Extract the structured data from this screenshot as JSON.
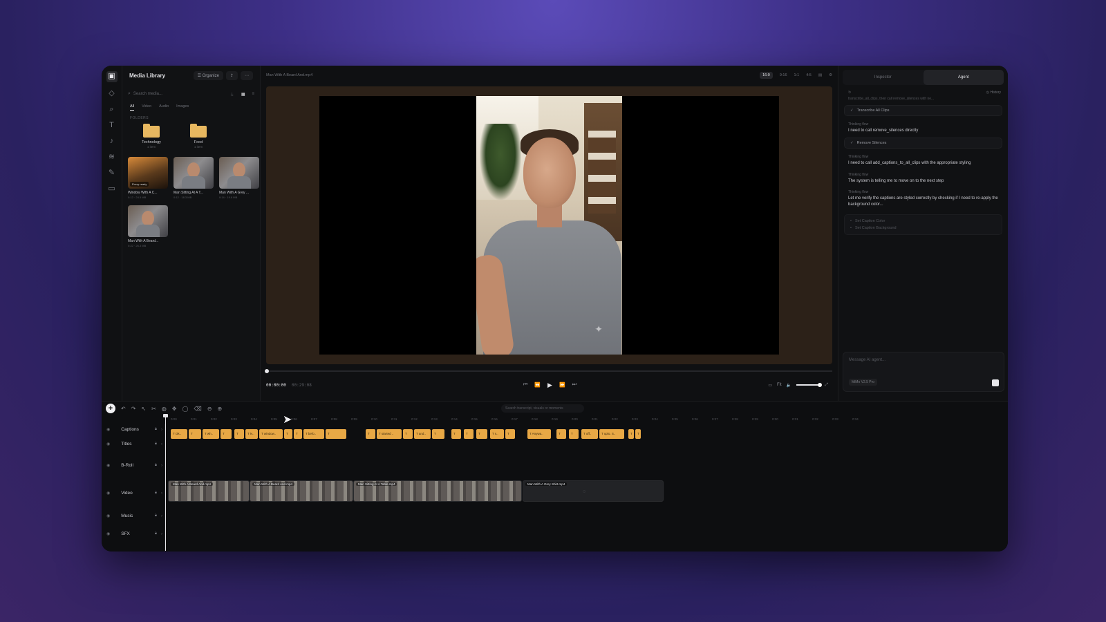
{
  "rail": {
    "icons": [
      "media-icon",
      "layers-icon",
      "search-icon",
      "text-icon",
      "music-icon",
      "stack-icon",
      "pin-icon",
      "trash-icon"
    ]
  },
  "media": {
    "title": "Media Library",
    "organize_label": "Organize",
    "search_placeholder": "Search media...",
    "tabs": [
      "All",
      "Video",
      "Audio",
      "Images"
    ],
    "section": "FOLDERS",
    "folders": [
      {
        "name": "Technology",
        "count": "1 item"
      },
      {
        "name": "Food",
        "count": "1 item"
      }
    ],
    "items": [
      {
        "name": "Window With A C...",
        "meta": "0:12 · 24.5 MB",
        "badge": "Proxy ready"
      },
      {
        "name": "Man Sitting At A T...",
        "meta": "0:12 · 18.3 MB",
        "badge": ""
      },
      {
        "name": "Man With A Grey ...",
        "meta": "0:14 · 19.8 MB",
        "badge": ""
      },
      {
        "name": "Man With A Beard...",
        "meta": "0:22 · 26.3 MB",
        "badge": ""
      }
    ]
  },
  "preview": {
    "filename": "Man With A Beard And.mp4",
    "aspect": "16:9",
    "ratios": [
      "9:16",
      "1:1",
      "4:5"
    ],
    "timecode": "00:00:00",
    "duration": "00:29:08",
    "fit_label": "Fit",
    "volume": 0.8
  },
  "agent": {
    "tabs": [
      "Inspector",
      "Agent"
    ],
    "history_label": "History",
    "truncated": "transcribe_all_clips, then call remove_silences with ne...",
    "steps": [
      {
        "kind": "done",
        "text": "Transcribe All Clips"
      },
      {
        "kind": "thinking",
        "label": "Thinking flow",
        "text": "I need to call remove_silences directly"
      },
      {
        "kind": "done",
        "text": "Remove Silences"
      },
      {
        "kind": "thinking",
        "label": "Thinking flow",
        "text": "I need to call add_captions_to_all_clips with the appropriate styling"
      },
      {
        "kind": "thinking",
        "label": "Thinking flow",
        "text": "The system is telling me to move on to the next step"
      },
      {
        "kind": "thinking",
        "label": "Thinking flow",
        "text": "Let me verify the captions are styled correctly by checking if I need to re-apply the background color..."
      }
    ],
    "pending": [
      "Set Caption Color",
      "Set Caption Background"
    ],
    "input_placeholder": "Message AI agent...",
    "model": "MiMo V2.5 Pro"
  },
  "timeline": {
    "search_placeholder": "Search transcript, visuals or moments",
    "ruler": [
      "0:00",
      "0:01",
      "0:02",
      "0:03",
      "0:04",
      "0:05",
      "0:06",
      "0:07",
      "0:08",
      "0:09",
      "0:10",
      "0:11",
      "0:12",
      "0:13",
      "0:14",
      "0:15",
      "0:16",
      "0:17",
      "0:18",
      "0:19",
      "0:20",
      "0:21",
      "0:22",
      "0:23",
      "0:24",
      "0:25",
      "0:26",
      "0:27",
      "0:28",
      "0:29",
      "0:30",
      "0:31",
      "0:32",
      "0:33",
      "0:34"
    ],
    "tracks": [
      "Captions",
      "Titles",
      "B-Roll",
      "Video",
      "Music",
      "SFX"
    ],
    "captions": [
      "T Ok..",
      "T",
      "T wh..",
      "T",
      "T",
      "T N..",
      "T window..",
      "T",
      "T",
      "T befo..",
      "T",
      "T",
      "T started ..",
      "T",
      "T and..",
      "T",
      "T",
      "T",
      "T",
      "T s..",
      "T",
      "T Anywa..",
      "T",
      "T",
      "T off..",
      "T uplo. S..",
      "T",
      "T"
    ],
    "video_clips": [
      {
        "name": "Man With A Beard And.mp4"
      },
      {
        "name": "Man With A Beard And.mp4"
      },
      {
        "name": "Man Sitting At A Table.mp4"
      },
      {
        "name": "Man With A Grey Shirt.mp4"
      }
    ]
  }
}
